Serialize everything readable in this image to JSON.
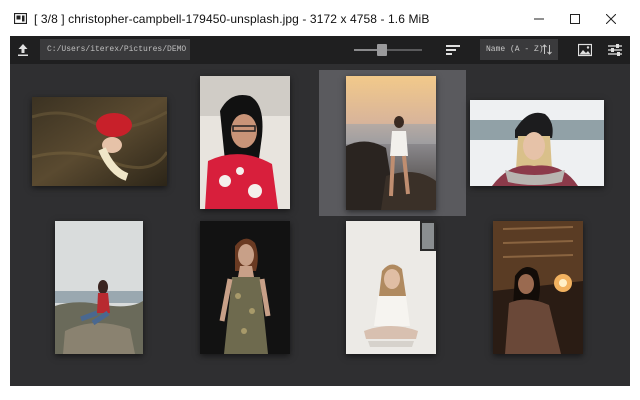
{
  "window": {
    "title": "[ 3/8 ]  christopher-campbell-179450-unsplash.jpg  -  3172 x 4758  -  1.6 MiB",
    "minimize_icon": "minimize-icon",
    "maximize_icon": "maximize-icon",
    "close_icon": "close-icon"
  },
  "toolbar": {
    "upload_icon": "upload-icon",
    "path": "C:/Users/iterex/Pictures/DEMO",
    "zoom_level": 0.4,
    "sort_icon": "sort-lines-icon",
    "sort_option": "Name (A - Z)",
    "sort_direction_icon": "sort-direction-icon",
    "image_icon": "image-icon",
    "settings_icon": "settings-sliders-icon"
  },
  "gallery": {
    "current_index": 3,
    "total": 8,
    "thumbnails": [
      {
        "subject": "woman lying in dry grass, red top"
      },
      {
        "subject": "woman with glasses, red floral shirt"
      },
      {
        "subject": "woman in white on rocks at sunset beach"
      },
      {
        "subject": "woman in black beanie, snowy background"
      },
      {
        "subject": "woman sitting on rocks by the sea"
      },
      {
        "subject": "woman in floral dress, dark background"
      },
      {
        "subject": "woman sitting with open book, white room"
      },
      {
        "subject": "woman holding lantern in dark room"
      }
    ]
  },
  "colors": {
    "toolbar_bg": "#1f1f20",
    "gallery_bg": "#2f2f31",
    "selection": "#5a5a5e",
    "field_bg": "#3a3a3c"
  }
}
